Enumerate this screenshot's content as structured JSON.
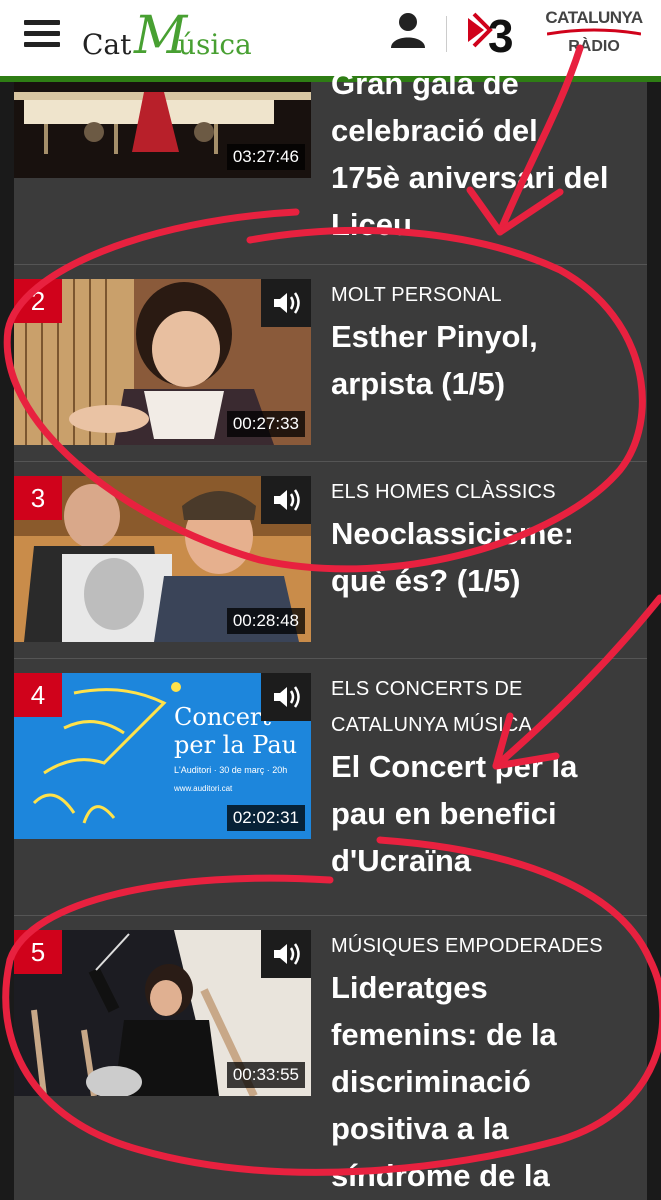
{
  "header": {
    "logo_cat": "Cat",
    "logo_m": "M",
    "logo_rest": "úsica",
    "tv3_label": "3",
    "radio_line1": "CATALUNYA",
    "radio_line2": "RÀDIO"
  },
  "colors": {
    "header_bg": "#ffffff",
    "header_accent": "#2e7d14",
    "list_bg": "#3b3b3b",
    "rank_badge": "#d0021b",
    "annotation": "#e8213f"
  },
  "items": [
    {
      "kicker": "",
      "title_lines": [
        "Gran gala de",
        "celebració del",
        "175è aniversari del",
        "Liceu"
      ],
      "duration": "03:27:46",
      "rank": "",
      "icon": "speaker-icon"
    },
    {
      "kicker": "MOLT PERSONAL",
      "title_lines": [
        "Esther Pinyol,",
        "arpista (1/5)"
      ],
      "duration": "00:27:33",
      "rank": "2",
      "icon": "speaker-icon"
    },
    {
      "kicker": "ELS HOMES CLÀSSICS",
      "title_lines": [
        "Neoclassicisme:",
        "què és? (1/5)"
      ],
      "duration": "00:28:48",
      "rank": "3",
      "icon": "speaker-icon"
    },
    {
      "kicker_lines": [
        "ELS CONCERTS DE",
        "CATALUNYA MÚSICA"
      ],
      "title_lines": [
        "El Concert per la",
        "pau en benefici",
        "d'Ucraïna"
      ],
      "duration": "02:02:31",
      "rank": "4",
      "thumb_text": [
        "Concert",
        "per la Pau",
        "L'Auditori · 30 de març · 20h",
        "www.auditori.cat"
      ],
      "icon": "speaker-icon"
    },
    {
      "kicker": "MÚSIQUES EMPODERADES",
      "title_lines": [
        "Lideratges",
        "femenins: de la",
        "discriminació",
        "positiva a la",
        "síndrome de la"
      ],
      "duration": "00:33:55",
      "rank": "5",
      "icon": "speaker-icon"
    }
  ]
}
